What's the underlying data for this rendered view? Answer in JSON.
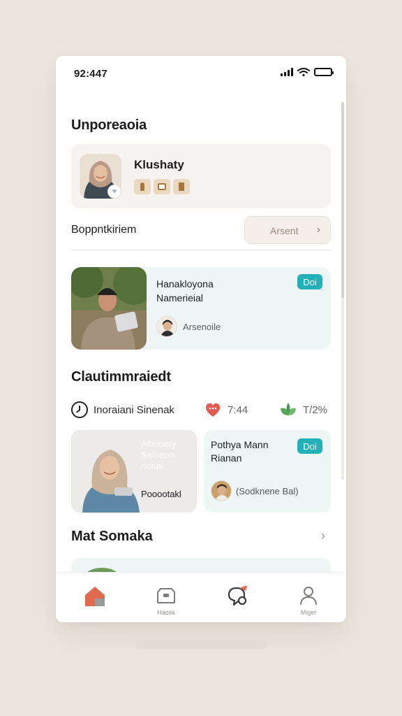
{
  "status_bar": {
    "time": "92:447"
  },
  "sections": {
    "profile_title": "Unporeaoia",
    "category_title": "Clautimmraiedt",
    "list_title": "Mat Somaka"
  },
  "profile": {
    "name": "Klushaty"
  },
  "appointment": {
    "label": "Boppntkiriem",
    "button_label": "Arsent"
  },
  "feature": {
    "title": "Hanakloyona\nNamerieial",
    "badge": "Doi",
    "author": "Arsenoile"
  },
  "stats": [
    {
      "label": "Inoraiani Sinenak",
      "icon": "clock-icon"
    },
    {
      "value": "7:44",
      "icon": "heart-icon",
      "color": "#e55b4f"
    },
    {
      "value": "T/2%",
      "icon": "leaf-icon",
      "color": "#58a65c"
    }
  ],
  "cards": {
    "left": {
      "faded_text": "Aitaioery\nSaioaon\nnonai",
      "label": "Pooootakl"
    },
    "right": {
      "title": "Pothya Mann\nRianan",
      "badge": "Doi",
      "author": "(Sodknene Bal)"
    }
  },
  "tabs": [
    {
      "label": "",
      "icon": "home-icon",
      "active": true
    },
    {
      "label": "Haosk",
      "icon": "box-icon"
    },
    {
      "label": "",
      "icon": "message-icon"
    },
    {
      "label": "Miger",
      "icon": "profile-icon"
    }
  ],
  "colors": {
    "accent": "#e06a4e",
    "teal": "#22b1b8",
    "card_tint": "#eef7f6",
    "background": "#ece6de"
  }
}
